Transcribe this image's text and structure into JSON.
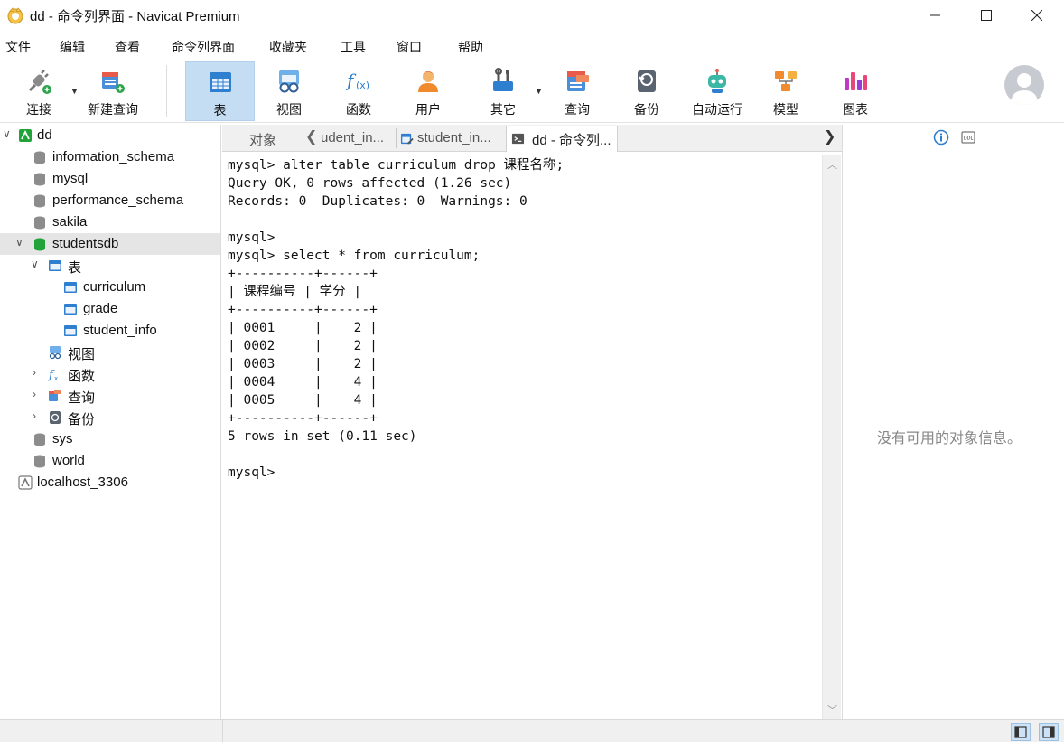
{
  "window": {
    "title": "dd - 命令列界面 - Navicat Premium"
  },
  "menu": [
    "文件",
    "编辑",
    "查看",
    "命令列界面",
    "收藏夹",
    "工具",
    "窗口",
    "帮助"
  ],
  "toolbar": {
    "connect": "连接",
    "new_query": "新建查询",
    "table": "表",
    "view": "视图",
    "function": "函数",
    "user": "用户",
    "other": "其它",
    "query": "查询",
    "backup": "备份",
    "automation": "自动运行",
    "model": "模型",
    "chart": "图表"
  },
  "tree": {
    "connection": "dd",
    "dbs": {
      "information_schema": "information_schema",
      "mysql": "mysql",
      "performance_schema": "performance_schema",
      "sakila": "sakila",
      "studentsdb": "studentsdb",
      "sys": "sys",
      "world": "world"
    },
    "tables_folder": "表",
    "tables": [
      "curriculum",
      "grade",
      "student_info"
    ],
    "views_folder": "视图",
    "functions_folder": "函数",
    "queries_folder": "查询",
    "backups_folder": "备份",
    "other_connection": "localhost_3306"
  },
  "tabs": {
    "objects": "对象",
    "tab1": "udent_in...",
    "tab2": "student_in...",
    "tab3": "dd - 命令列..."
  },
  "console": {
    "text": "mysql> alter table curriculum drop 课程名称;\nQuery OK, 0 rows affected (1.26 sec)\nRecords: 0  Duplicates: 0  Warnings: 0\n\nmysql>\nmysql> select * from curriculum;\n+----------+------+\n| 课程编号 | 学分 |\n+----------+------+\n| 0001     |    2 |\n| 0002     |    2 |\n| 0003     |    2 |\n| 0004     |    4 |\n| 0005     |    4 |\n+----------+------+\n5 rows in set (0.11 sec)\n\nmysql> "
  },
  "info_panel": {
    "empty_message": "没有可用的对象信息。",
    "ddl_label": "DDL"
  },
  "colors": {
    "accent": "#2f7fd0",
    "active_tab": "#c5ddf2",
    "db_green": "#21a33a"
  }
}
